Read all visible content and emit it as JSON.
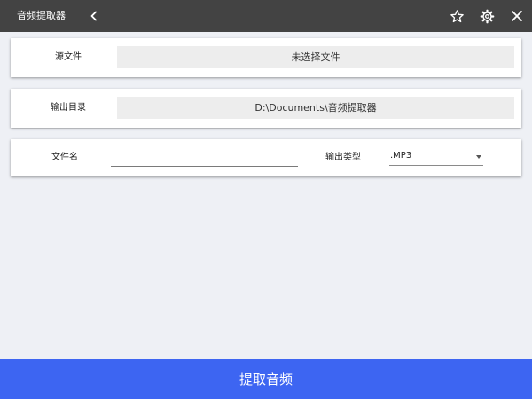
{
  "app": {
    "title": "音频提取器"
  },
  "titlebar": {
    "icons": [
      "chevron-left-icon",
      "star-icon",
      "gear-icon",
      "close-icon"
    ]
  },
  "source": {
    "label": "源文件",
    "value": "未选择文件"
  },
  "output_dir": {
    "label": "输出目录",
    "value": "D:\\Documents\\音频提取器"
  },
  "filename": {
    "label": "文件名",
    "value": ""
  },
  "output_type": {
    "label": "输出类型",
    "selected": ".MP3"
  },
  "action": {
    "label": "提取音频"
  },
  "colors": {
    "titlebar": "#434343",
    "background": "#eef0f5",
    "accent": "#3d65f2",
    "field": "#ededed"
  }
}
